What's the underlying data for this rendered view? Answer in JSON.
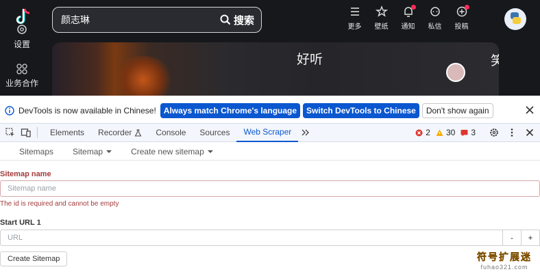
{
  "app": {
    "settings_label": "设置",
    "business_label": "业务合作",
    "search": {
      "value": "颜志琳",
      "button_label": "搜索"
    },
    "top_icons": [
      {
        "icon": "menu-icon",
        "label": "更多",
        "badge": false
      },
      {
        "icon": "wallpaper-icon",
        "label": "壁纸",
        "badge": false
      },
      {
        "icon": "bell-icon",
        "label": "通知",
        "badge": true
      },
      {
        "icon": "message-icon",
        "label": "私信",
        "badge": false
      },
      {
        "icon": "upload-icon",
        "label": "投稿",
        "badge": true
      }
    ],
    "hero_text": "好听",
    "hero_text_2": "笑"
  },
  "infobar": {
    "message": "DevTools is now available in Chinese!",
    "btn_match": "Always match Chrome's language",
    "btn_switch": "Switch DevTools to Chinese",
    "btn_dont_show": "Don't show again"
  },
  "devtools": {
    "tabs": [
      "Elements",
      "Recorder",
      "Console",
      "Sources",
      "Web Scraper"
    ],
    "active_tab": "Web Scraper",
    "errors": "2",
    "warnings": "30",
    "issues": "3"
  },
  "scraper": {
    "subnav": [
      "Sitemaps",
      "Sitemap",
      "Create new sitemap"
    ],
    "sitemap_name_label": "Sitemap name",
    "sitemap_name_placeholder": "Sitemap name",
    "error_text": "The id is required and cannot be empty",
    "start_url_label": "Start URL 1",
    "url_placeholder": "URL",
    "minus": "-",
    "plus": "+",
    "create_button": "Create Sitemap"
  },
  "watermark": {
    "line1": "符号扩展迷",
    "line2": "fuhao321.com"
  },
  "colors": {
    "accent_blue": "#0b57d0",
    "error_red": "#a33a3a",
    "badge_red": "#fe2c55",
    "app_bg": "#17181c"
  }
}
